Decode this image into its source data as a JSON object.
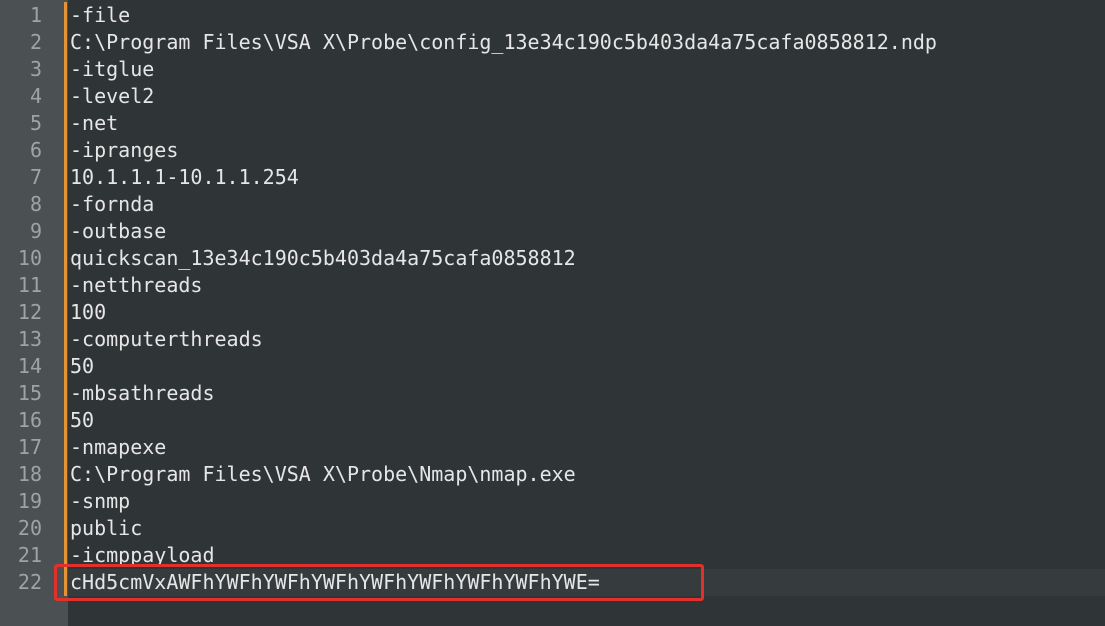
{
  "editor": {
    "lines": [
      {
        "num": "1",
        "text": "-file"
      },
      {
        "num": "2",
        "text": "C:\\Program Files\\VSA X\\Probe\\config_13e34c190c5b403da4a75cafa0858812.ndp"
      },
      {
        "num": "3",
        "text": "-itglue"
      },
      {
        "num": "4",
        "text": "-level2"
      },
      {
        "num": "5",
        "text": "-net"
      },
      {
        "num": "6",
        "text": "-ipranges"
      },
      {
        "num": "7",
        "text": "10.1.1.1-10.1.1.254"
      },
      {
        "num": "8",
        "text": "-fornda"
      },
      {
        "num": "9",
        "text": "-outbase"
      },
      {
        "num": "10",
        "text": "quickscan_13e34c190c5b403da4a75cafa0858812"
      },
      {
        "num": "11",
        "text": "-netthreads"
      },
      {
        "num": "12",
        "text": "100"
      },
      {
        "num": "13",
        "text": "-computerthreads"
      },
      {
        "num": "14",
        "text": "50"
      },
      {
        "num": "15",
        "text": "-mbsathreads"
      },
      {
        "num": "16",
        "text": "50"
      },
      {
        "num": "17",
        "text": "-nmapexe"
      },
      {
        "num": "18",
        "text": "C:\\Program Files\\VSA X\\Probe\\Nmap\\nmap.exe"
      },
      {
        "num": "19",
        "text": "-snmp"
      },
      {
        "num": "20",
        "text": "public"
      },
      {
        "num": "21",
        "text": "-icmppayload"
      },
      {
        "num": "22",
        "text": "cHd5cmVxAWFhYWFhYWFhYWFhYWFhYWFhYWFhYWFhYWE="
      }
    ],
    "current_line": "22"
  },
  "colors": {
    "background": "#2f3436",
    "gutter": "#4b5153",
    "text": "#e6e6e6",
    "line_number": "#9ea4a6",
    "fold_marker": "#e49437",
    "highlight_border": "#e0312c"
  }
}
